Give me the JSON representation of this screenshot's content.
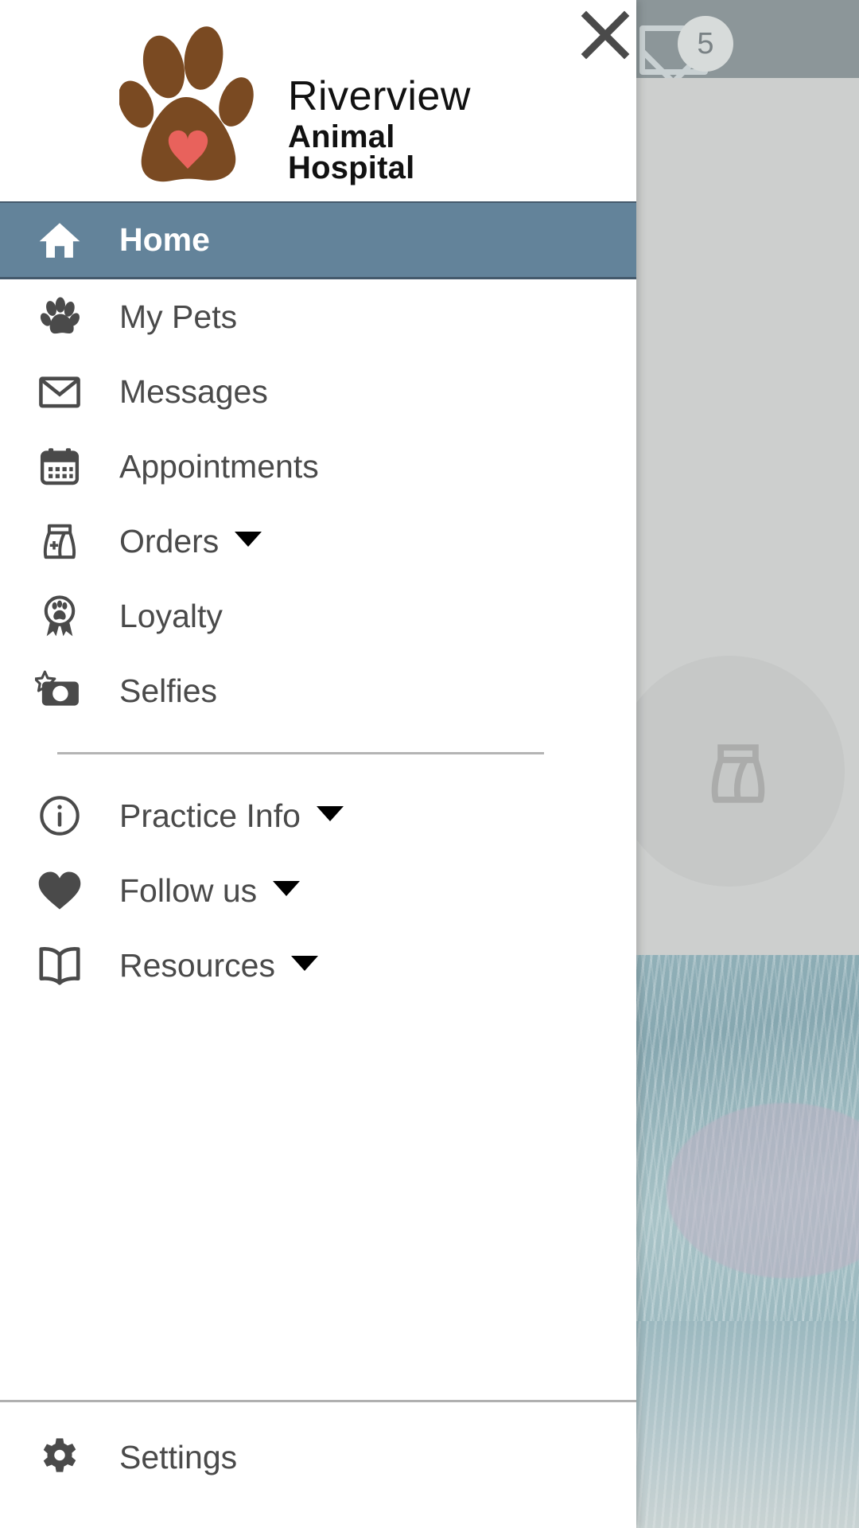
{
  "app": {
    "logo_line1": "Riverview",
    "logo_line2": "Animal Hospital",
    "logo_icon": "paw-print-heart-logo"
  },
  "drawer": {
    "close_label": "✕",
    "close_icon": "close-icon",
    "accent_color": "#63839a",
    "text_color": "#4a4a4a",
    "primary_items": [
      {
        "label": "Home",
        "icon": "home-icon",
        "active": true,
        "has_caret": false
      },
      {
        "label": "My Pets",
        "icon": "paw-icon",
        "active": false,
        "has_caret": false
      },
      {
        "label": "Messages",
        "icon": "envelope-icon",
        "active": false,
        "has_caret": false
      },
      {
        "label": "Appointments",
        "icon": "calendar-icon",
        "active": false,
        "has_caret": false
      },
      {
        "label": "Orders",
        "icon": "food-bag-plus-icon",
        "active": false,
        "has_caret": true
      },
      {
        "label": "Loyalty",
        "icon": "award-paw-icon",
        "active": false,
        "has_caret": false
      },
      {
        "label": "Selfies",
        "icon": "camera-star-icon",
        "active": false,
        "has_caret": false
      }
    ],
    "secondary_items": [
      {
        "label": "Practice Info",
        "icon": "info-circle-icon",
        "has_caret": true
      },
      {
        "label": "Follow us",
        "icon": "heart-icon",
        "has_caret": true
      },
      {
        "label": "Resources",
        "icon": "book-icon",
        "has_caret": true
      }
    ],
    "footer_items": [
      {
        "label": "Settings",
        "icon": "gear-icon",
        "has_caret": false
      }
    ]
  },
  "backdrop": {
    "mail_icon": "envelope-icon",
    "mail_badge_count": "5",
    "content_icon": "food-bag-icon",
    "header_color": "#8c9699",
    "body_color": "#cdcfce"
  }
}
